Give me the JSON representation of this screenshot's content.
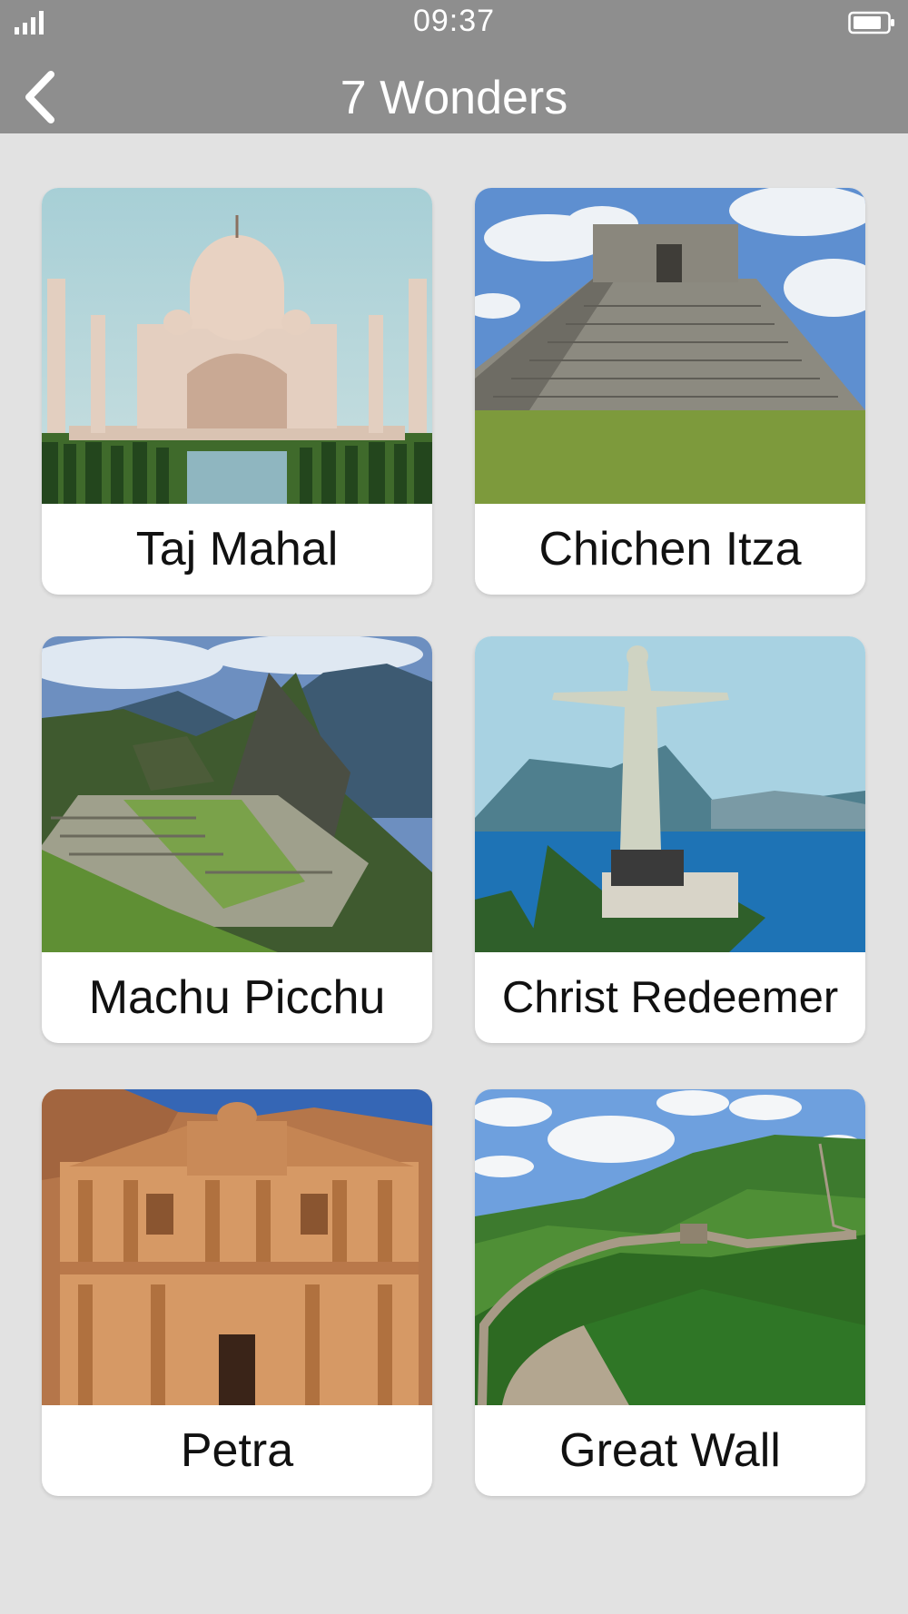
{
  "status": {
    "time": "09:37",
    "signal_icon": "signal-icon",
    "battery_icon": "battery-icon"
  },
  "header": {
    "title": "7 Wonders",
    "back_icon": "chevron-left-icon"
  },
  "wonders": [
    {
      "label": "Taj Mahal"
    },
    {
      "label": "Chichen Itza"
    },
    {
      "label": "Machu Picchu"
    },
    {
      "label": "Christ Redeemer"
    },
    {
      "label": "Petra"
    },
    {
      "label": "Great Wall"
    }
  ],
  "colors": {
    "header": "#8e8e8e",
    "background": "#e2e2e2",
    "card": "#ffffff"
  }
}
